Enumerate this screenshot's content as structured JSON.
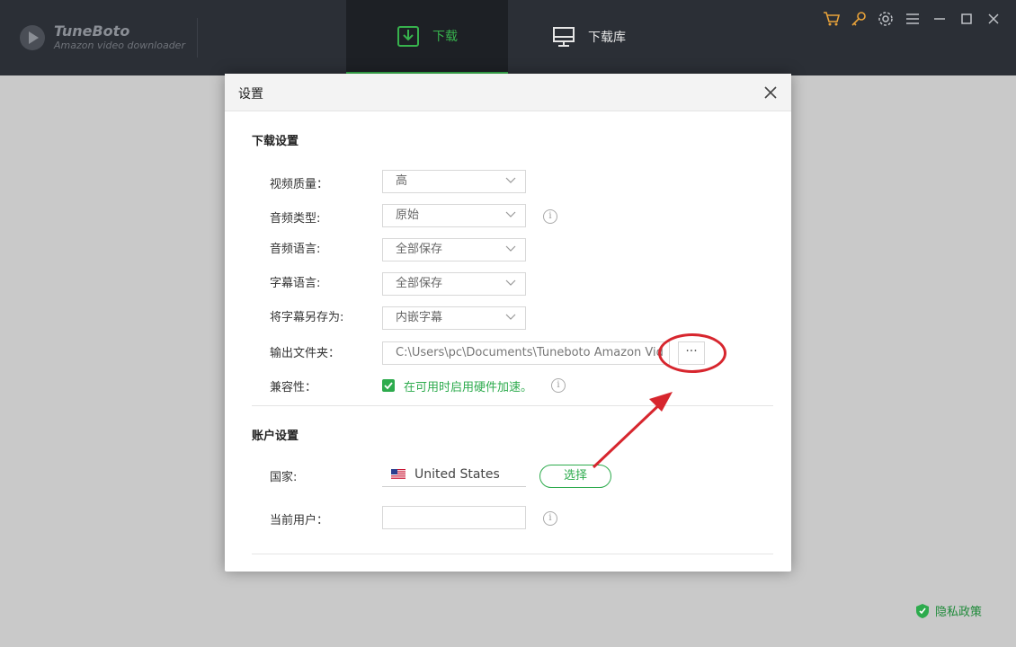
{
  "app": {
    "name": "TuneBoto",
    "subtitle": "Amazon video downloader"
  },
  "nav": {
    "download_label": "下载",
    "library_label": "下载库"
  },
  "colors": {
    "accent": "#2dab4d",
    "titlebar": "#2b2f36",
    "annotation": "#d7262e",
    "icon_orange": "#e8a23a"
  },
  "window_controls": [
    "cart-icon",
    "key-icon",
    "gear-icon",
    "menu-icon",
    "minimize-icon",
    "maximize-icon",
    "close-icon"
  ],
  "dialog": {
    "title": "设置",
    "download_section": {
      "title": "下载设置",
      "video_quality": {
        "label": "视频质量：",
        "value": "高"
      },
      "audio_type": {
        "label": "音频类型:",
        "value": "原始"
      },
      "audio_language": {
        "label": "音频语言:",
        "value": "全部保存"
      },
      "subtitle_language": {
        "label": "字幕语言:",
        "value": "全部保存"
      },
      "save_subtitle_as": {
        "label": "将字幕另存为:",
        "value": "内嵌字幕"
      },
      "output_folder": {
        "label": "输出文件夹：",
        "value": "C:\\Users\\pc\\Documents\\Tuneboto Amazon Vid",
        "browse": "···"
      },
      "compatibility": {
        "label": "兼容性：",
        "checkbox_label": "在可用时启用硬件加速。",
        "checked": true
      }
    },
    "account_section": {
      "title": "账户设置",
      "country": {
        "label": "国家:",
        "value": "United States",
        "button": "选择"
      },
      "current_user": {
        "label": "当前用户：",
        "value": ""
      }
    }
  },
  "footer": {
    "privacy": "隐私政策"
  }
}
